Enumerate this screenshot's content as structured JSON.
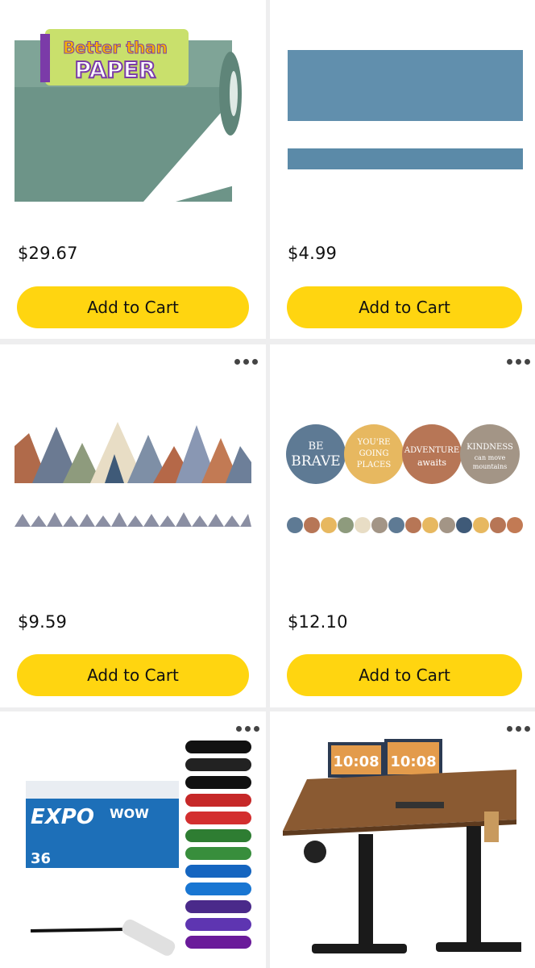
{
  "products": [
    {
      "price": "$29.67",
      "button": "Add to Cart",
      "image": {
        "brand_line1": "Better than",
        "brand_line2": "PAPER"
      }
    },
    {
      "price": "$4.99",
      "button": "Add to Cart"
    },
    {
      "price": "$9.59",
      "button": "Add to Cart"
    },
    {
      "price": "$12.10",
      "button": "Add to Cart",
      "image": {
        "d1a": "BE",
        "d1b": "BRAVE",
        "d2a": "YOU'RE",
        "d2b": "GOING",
        "d2c": "PLACES",
        "d3a": "ADVENTURE",
        "d3b": "awaits",
        "d4a": "KINDNESS",
        "d4b": "can move",
        "d4c": "mountains"
      }
    },
    {
      "image": {
        "brand": "EXPO",
        "label": "WOW",
        "count": "36"
      }
    },
    {
      "image": {
        "screen_time": "10:08"
      }
    }
  ],
  "icons": {
    "more": "more-options-icon"
  },
  "colors": {
    "button_bg": "#ffd510",
    "page_bg": "#eeeeef"
  }
}
